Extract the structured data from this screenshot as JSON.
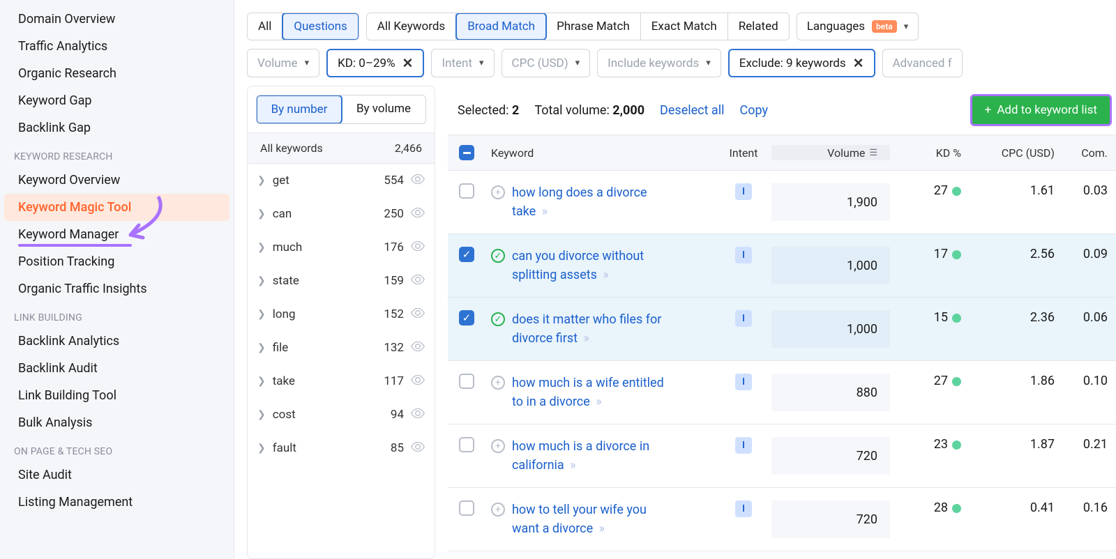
{
  "sidebar": {
    "groups": [
      {
        "title": null,
        "items": [
          {
            "label": "Domain Overview"
          },
          {
            "label": "Traffic Analytics"
          },
          {
            "label": "Organic Research"
          },
          {
            "label": "Keyword Gap"
          },
          {
            "label": "Backlink Gap"
          }
        ]
      },
      {
        "title": "KEYWORD RESEARCH",
        "items": [
          {
            "label": "Keyword Overview"
          },
          {
            "label": "Keyword Magic Tool",
            "active": true
          },
          {
            "label": "Keyword Manager",
            "highlight": true
          },
          {
            "label": "Position Tracking"
          },
          {
            "label": "Organic Traffic Insights"
          }
        ]
      },
      {
        "title": "LINK BUILDING",
        "items": [
          {
            "label": "Backlink Analytics"
          },
          {
            "label": "Backlink Audit"
          },
          {
            "label": "Link Building Tool"
          },
          {
            "label": "Bulk Analysis"
          }
        ]
      },
      {
        "title": "ON PAGE & TECH SEO",
        "items": [
          {
            "label": "Site Audit"
          },
          {
            "label": "Listing Management"
          }
        ]
      }
    ]
  },
  "filters": {
    "row1": {
      "group1": [
        {
          "label": "All"
        },
        {
          "label": "Questions",
          "selected": true
        }
      ],
      "group2": [
        {
          "label": "All Keywords"
        },
        {
          "label": "Broad Match",
          "selected": true
        },
        {
          "label": "Phrase Match"
        },
        {
          "label": "Exact Match"
        },
        {
          "label": "Related"
        }
      ],
      "lang": {
        "label": "Languages",
        "beta": "beta"
      }
    },
    "row2": [
      {
        "label": "Volume",
        "caret": true,
        "muted": true
      },
      {
        "label": "KD: 0–29%",
        "close": true,
        "active": true
      },
      {
        "label": "Intent",
        "caret": true,
        "muted": true
      },
      {
        "label": "CPC (USD)",
        "caret": true,
        "muted": true
      },
      {
        "label": "Include keywords",
        "caret": true,
        "muted": true
      },
      {
        "label": "Exclude: 9 keywords",
        "close": true,
        "active": true
      },
      {
        "label": "Advanced f",
        "muted": true
      }
    ]
  },
  "groups_panel": {
    "toggle": {
      "by_number": "By number",
      "by_volume": "By volume"
    },
    "header": {
      "label": "All keywords",
      "count": "2,466"
    },
    "items": [
      {
        "label": "get",
        "count": 554
      },
      {
        "label": "can",
        "count": 250
      },
      {
        "label": "much",
        "count": 176
      },
      {
        "label": "state",
        "count": 159
      },
      {
        "label": "long",
        "count": 152
      },
      {
        "label": "file",
        "count": 132
      },
      {
        "label": "take",
        "count": 117
      },
      {
        "label": "cost",
        "count": 94
      },
      {
        "label": "fault",
        "count": 85
      }
    ]
  },
  "results": {
    "selected_label": "Selected:",
    "selected_count": "2",
    "totvol_label": "Total volume:",
    "totvol": "2,000",
    "deselect": "Deselect all",
    "copy": "Copy",
    "add_btn": "Add to keyword list",
    "columns": {
      "keyword": "Keyword",
      "intent": "Intent",
      "volume": "Volume",
      "kd": "KD %",
      "cpc": "CPC (USD)",
      "com": "Com."
    },
    "rows": [
      {
        "checked": false,
        "added": false,
        "keyword": "how long does a divorce take",
        "intent": "I",
        "volume": "1,900",
        "kd": "27",
        "cpc": "1.61",
        "com": "0.03"
      },
      {
        "checked": true,
        "added": true,
        "keyword": "can you divorce without splitting assets",
        "intent": "I",
        "volume": "1,000",
        "kd": "17",
        "cpc": "2.56",
        "com": "0.09"
      },
      {
        "checked": true,
        "added": true,
        "keyword": "does it matter who files for divorce first",
        "intent": "I",
        "volume": "1,000",
        "kd": "15",
        "cpc": "2.36",
        "com": "0.06"
      },
      {
        "checked": false,
        "added": false,
        "keyword": "how much is a wife entitled to in a divorce",
        "intent": "I",
        "volume": "880",
        "kd": "27",
        "cpc": "1.86",
        "com": "0.10"
      },
      {
        "checked": false,
        "added": false,
        "keyword": "how much is a divorce in california",
        "intent": "I",
        "volume": "720",
        "kd": "23",
        "cpc": "1.87",
        "com": "0.21"
      },
      {
        "checked": false,
        "added": false,
        "keyword": "how to tell your wife you want a divorce",
        "intent": "I",
        "volume": "720",
        "kd": "28",
        "cpc": "0.41",
        "com": "0.16"
      }
    ]
  }
}
